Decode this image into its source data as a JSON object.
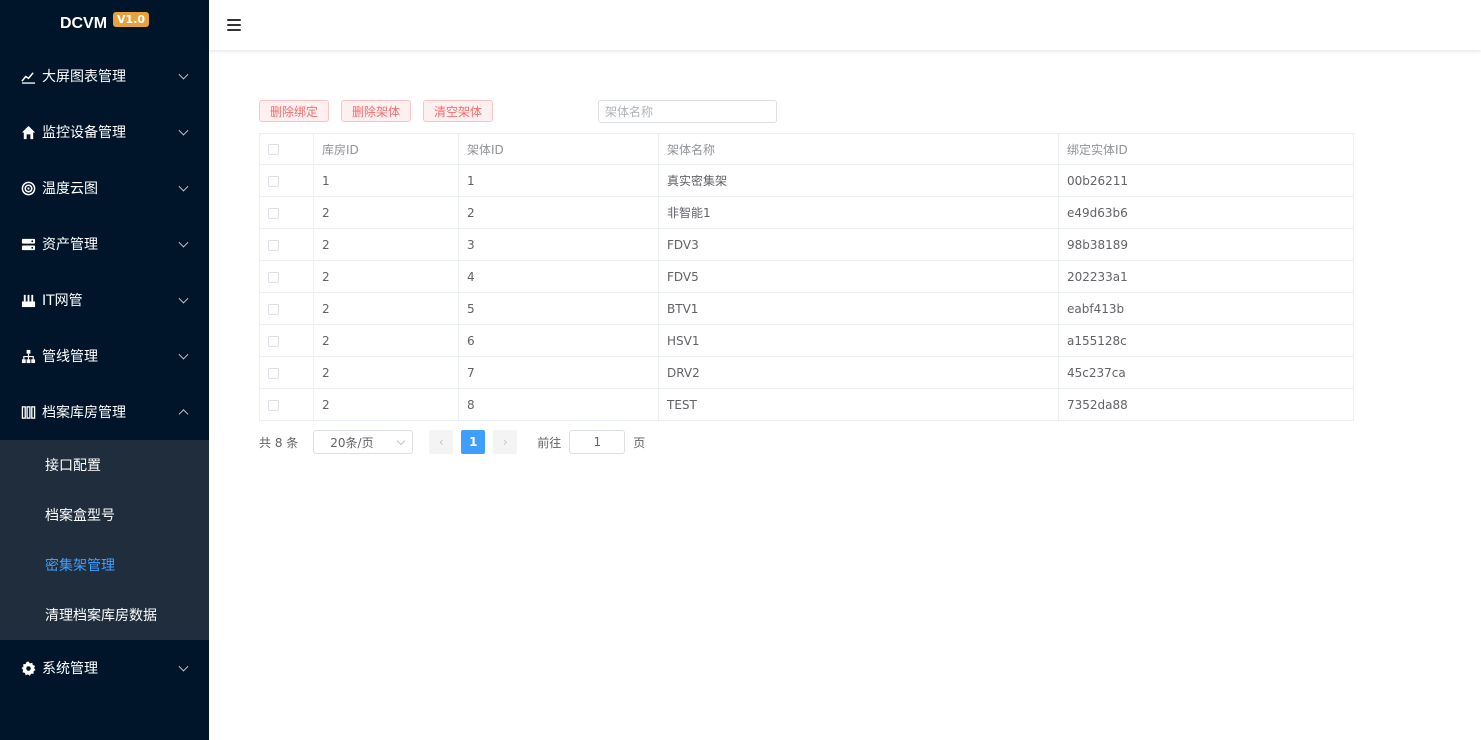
{
  "brand": {
    "name": "DCVM",
    "version": "V1.0"
  },
  "sidebar": {
    "items": [
      {
        "label": "大屏图表管理",
        "icon": "line-chart-icon"
      },
      {
        "label": "监控设备管理",
        "icon": "home-icon"
      },
      {
        "label": "温度云图",
        "icon": "target-icon"
      },
      {
        "label": "资产管理",
        "icon": "server-icon"
      },
      {
        "label": "IT网管",
        "icon": "network-device-icon"
      },
      {
        "label": "管线管理",
        "icon": "tree-icon"
      },
      {
        "label": "档案库房管理",
        "icon": "shelves-icon",
        "expanded": true,
        "children": [
          {
            "label": "接口配置"
          },
          {
            "label": "档案盒型号"
          },
          {
            "label": "密集架管理",
            "active": true
          },
          {
            "label": "清理档案库房数据"
          }
        ]
      },
      {
        "label": "系统管理",
        "icon": "gear-icon"
      }
    ]
  },
  "toolbar": {
    "delete_binding": "删除绑定",
    "delete_rack": "删除架体",
    "clear_racks": "清空架体",
    "search_placeholder": "架体名称"
  },
  "table": {
    "headers": [
      "库房ID",
      "架体ID",
      "架体名称",
      "绑定实体ID"
    ],
    "rows": [
      [
        "1",
        "1",
        "真实密集架",
        "00b26211"
      ],
      [
        "2",
        "2",
        "非智能1",
        "e49d63b6"
      ],
      [
        "2",
        "3",
        "FDV3",
        "98b38189"
      ],
      [
        "2",
        "4",
        "FDV5",
        "202233a1"
      ],
      [
        "2",
        "5",
        "BTV1",
        "eabf413b"
      ],
      [
        "2",
        "6",
        "HSV1",
        "a155128c"
      ],
      [
        "2",
        "7",
        "DRV2",
        "45c237ca"
      ],
      [
        "2",
        "8",
        "TEST",
        "7352da88"
      ]
    ]
  },
  "pager": {
    "total": "共 8 条",
    "page_size": "20条/页",
    "current_page": "1",
    "goto_label": "前往",
    "goto_value": "1",
    "page_suffix": "页"
  },
  "colors": {
    "sidebar_bg": "#001529",
    "submenu_bg": "#1f2d3d",
    "accent": "#409eff",
    "badge": "#e6a23c",
    "danger": "#f56c6c"
  }
}
